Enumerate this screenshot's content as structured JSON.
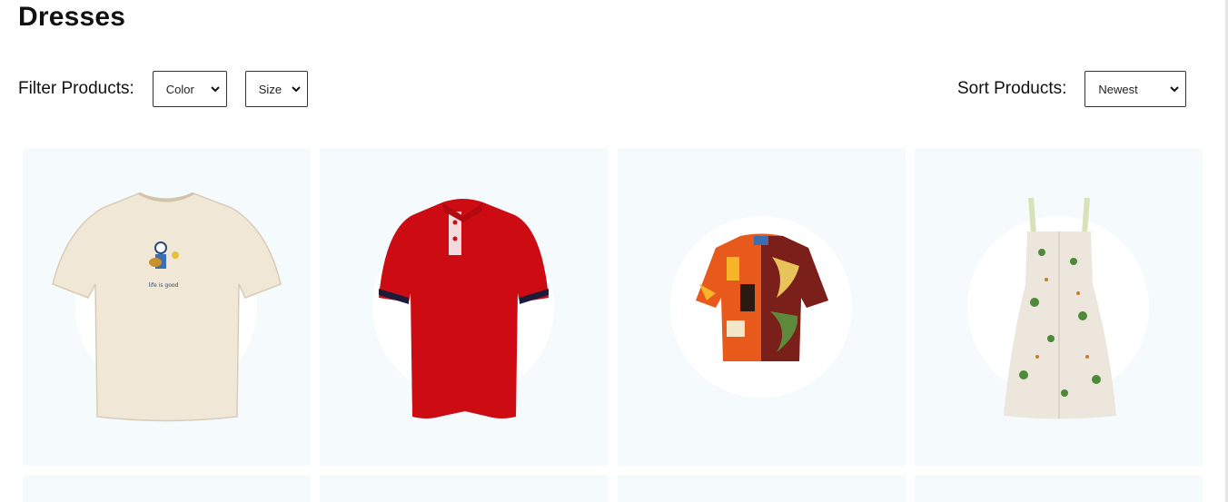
{
  "page": {
    "title": "Dresses"
  },
  "filters": {
    "label": "Filter Products:",
    "color": {
      "selected": "Color"
    },
    "size": {
      "selected": "Size"
    }
  },
  "sort": {
    "label": "Sort Products:",
    "selected": "Newest"
  },
  "products": [
    {
      "name": "cream-graphic-tshirt",
      "image_icon": "tshirt-icon",
      "color": "#f1e7d6"
    },
    {
      "name": "red-polo-shirt",
      "image_icon": "polo-shirt-icon",
      "color": "#cc0c12"
    },
    {
      "name": "patterned-camp-shirt",
      "image_icon": "shirt-icon",
      "color": "#e85a1c"
    },
    {
      "name": "palm-print-dress",
      "image_icon": "dress-icon",
      "color": "#ece6dc"
    }
  ],
  "colors": {
    "card_bg": "#f5fbfd",
    "text": "#111111"
  }
}
